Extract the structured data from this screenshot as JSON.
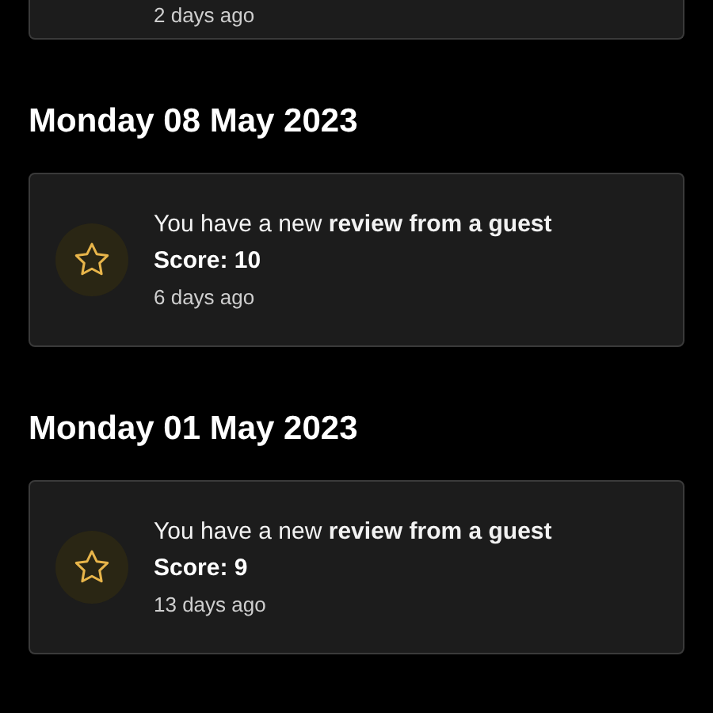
{
  "groups": [
    {
      "items": [
        {
          "time": "2 days ago"
        }
      ]
    },
    {
      "date": "Monday 08 May 2023",
      "items": [
        {
          "message": "You have a new **review from a guest**",
          "score": "Score: 10",
          "time": "6 days ago"
        }
      ]
    },
    {
      "date": "Monday 01 May 2023",
      "items": [
        {
          "message": "You have a new **review from a guest**",
          "score": "Score: 9",
          "time": "13 days ago"
        }
      ]
    }
  ]
}
